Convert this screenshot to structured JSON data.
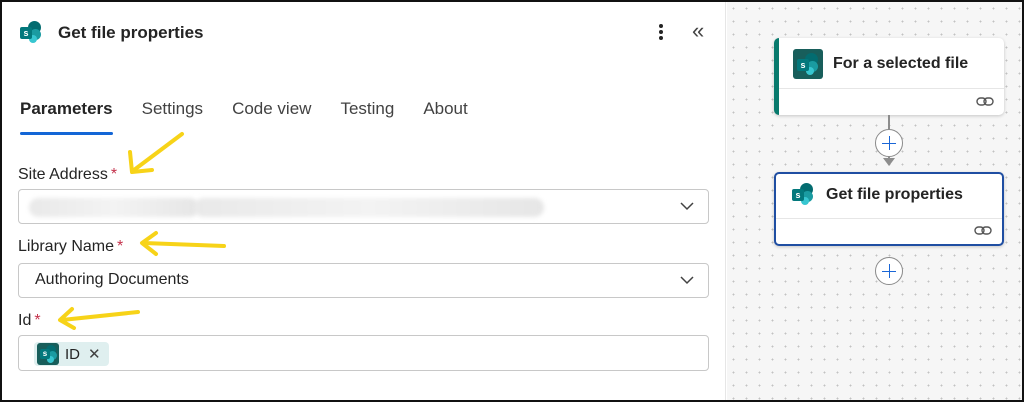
{
  "panel": {
    "title": "Get file properties",
    "tabs": [
      {
        "label": "Parameters",
        "active": true
      },
      {
        "label": "Settings",
        "active": false
      },
      {
        "label": "Code view",
        "active": false
      },
      {
        "label": "Testing",
        "active": false
      },
      {
        "label": "About",
        "active": false
      }
    ],
    "fields": {
      "site_address": {
        "label": "Site Address",
        "required_mark": "*",
        "value": ""
      },
      "library_name": {
        "label": "Library Name",
        "required_mark": "*",
        "value": "Authoring Documents"
      },
      "id": {
        "label": "Id",
        "required_mark": "*",
        "token": {
          "icon": "sharepoint-icon",
          "label": "ID",
          "remove": "✕"
        }
      }
    }
  },
  "canvas": {
    "cards": [
      {
        "title": "For a selected file",
        "icon": "sharepoint-icon"
      },
      {
        "title": "Get file properties",
        "icon": "sharepoint-icon"
      }
    ]
  },
  "icons": {
    "logo": "s",
    "collapse": "«",
    "chevron": "chevron-down-icon",
    "link": "link-icon",
    "add": "add-icon"
  },
  "colors": {
    "accent_tab": "#1366d6",
    "required": "#c4314b",
    "sharepoint": "#036c70",
    "selected_card_border": "#1f4ea2",
    "annotation_arrow": "#f7d318"
  }
}
